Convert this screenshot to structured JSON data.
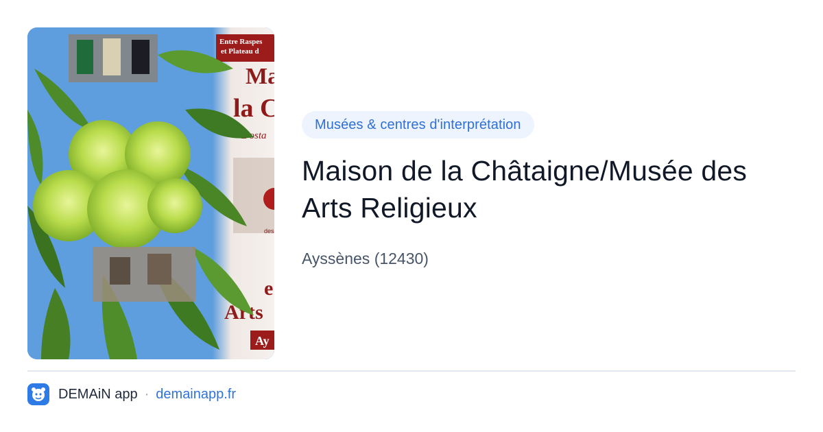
{
  "card": {
    "category": "Musées & centres d'interprétation",
    "title": "Maison de la Châtaigne/Musée des Arts Religieux",
    "location": "Ayssènes (12430)"
  },
  "image": {
    "poster_text_line1": "Entre Raspes",
    "poster_text_line2": "et Plateau d",
    "poster_big_1": "Ma",
    "poster_big_2": "la C",
    "poster_script": "L'osta",
    "poster_small": "des",
    "poster_e": "e",
    "poster_arts": "Arts",
    "poster_ay": "Ay"
  },
  "footer": {
    "app_name": "DEMAiN app",
    "separator": "·",
    "domain": "demainapp.fr"
  },
  "colors": {
    "chip_bg": "#edf4fd",
    "chip_text": "#2f6fd6",
    "link": "#2f73d9",
    "logo_bg": "#2e7be6"
  },
  "icons": {
    "app_logo": "demain-app-icon"
  }
}
